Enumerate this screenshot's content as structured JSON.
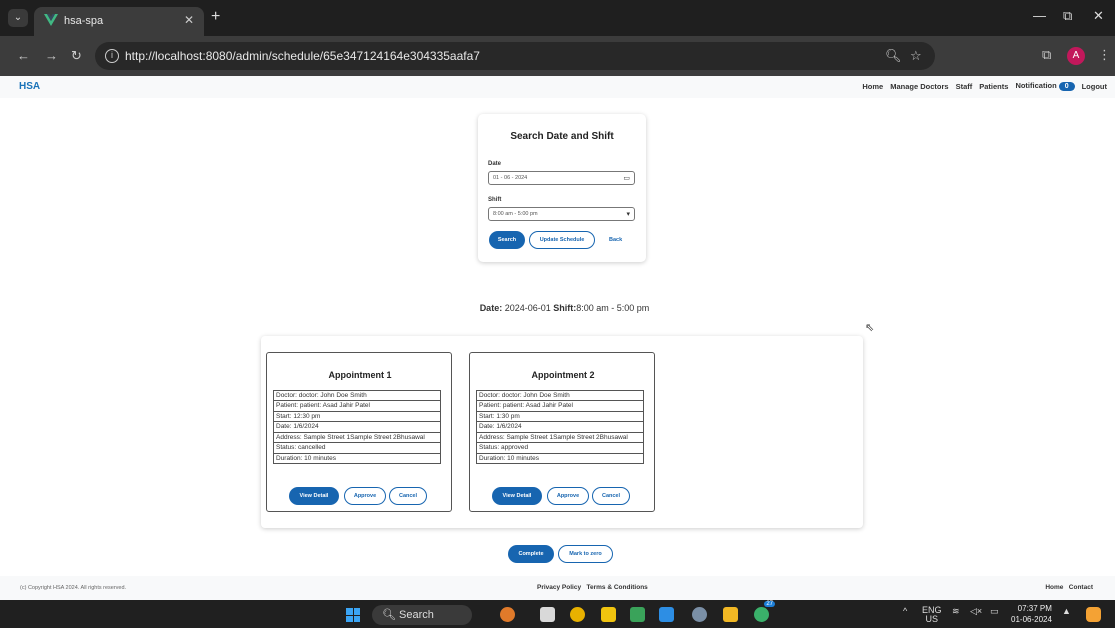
{
  "browser": {
    "tab_title": "hsa-spa",
    "url": "http://localhost:8080/admin/schedule/65e347124164e304335aafa7",
    "avatar_initial": "A"
  },
  "navbar": {
    "brand": "HSA",
    "links": [
      "Home",
      "Manage Doctors",
      "Staff",
      "Patients",
      "Notification"
    ],
    "notification_count": "0",
    "logout": "Logout"
  },
  "search": {
    "title": "Search Date and Shift",
    "date_label": "Date",
    "date_value": "01 - 06 - 2024",
    "shift_label": "Shift",
    "shift_value": "8:00 am - 5:00 pm",
    "search_btn": "Search",
    "update_btn": "Update Schedule",
    "back_btn": "Back"
  },
  "summary": {
    "date_label": "Date:",
    "date_value": " 2024-06-01 ",
    "shift_label": "Shift:",
    "shift_value": "8:00 am - 5:00 pm"
  },
  "appointments": [
    {
      "title": "Appointment 1",
      "rows": [
        "Doctor: doctor: John Doe Smith",
        "Patient: patient: Asad Jahir Patel",
        "Start: 12:30 pm",
        "Date: 1/6/2024",
        "Address: Sample Street 1Sample Street 2Bhusawal",
        "Status: cancelled",
        "Duration: 10 minutes"
      ],
      "buttons": {
        "view": "View Detail",
        "approve": "Approve",
        "cancel": "Cancel"
      }
    },
    {
      "title": "Appointment 2",
      "rows": [
        "Doctor: doctor: John Doe Smith",
        "Patient: patient: Asad Jahir Patel",
        "Start: 1:30 pm",
        "Date: 1/6/2024",
        "Address: Sample Street 1Sample Street 2Bhusawal",
        "Status: approved",
        "Duration: 10 minutes"
      ],
      "buttons": {
        "view": "View Detail",
        "approve": "Approve",
        "cancel": "Cancel"
      }
    }
  ],
  "bottom": {
    "complete": "Complete",
    "mark_zero": "Mark to zero"
  },
  "footer": {
    "copyright": "(c) Copyright HSA 2024. All rights reserved.",
    "privacy": "Privacy Policy",
    "terms": "Terms & Conditions",
    "home": "Home",
    "contact": "Contact"
  },
  "taskbar": {
    "search_label": "Search",
    "lang": "ENG",
    "region": "US",
    "time": "07:37 PM",
    "date": "01-06-2024",
    "badge": "27"
  },
  "colors": {
    "primary": "#1765b0",
    "brand": "#1a73b8"
  }
}
